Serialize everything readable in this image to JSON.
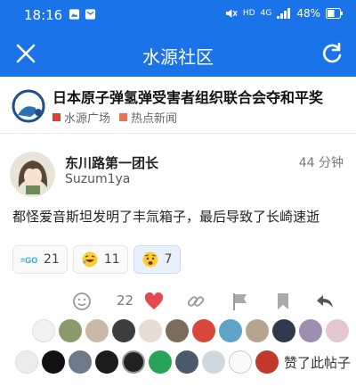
{
  "status": {
    "time": "18:16",
    "net_hd": "HD",
    "net_4g": "4G",
    "battery": "48%"
  },
  "appbar": {
    "title": "水源社区"
  },
  "topic": {
    "title": "日本原子弹氢弹受害者组织联合会夺和平奖",
    "categories": [
      {
        "label": "水源广场",
        "color": "#d94130"
      },
      {
        "label": "热点新闻",
        "color": "#e8744f"
      }
    ]
  },
  "post": {
    "author": "东川路第一团长",
    "handle": "Suzum1ya",
    "time": "44 分钟",
    "content": "都怪爱音斯坦发明了丰氚箱子，最后导致了长崎速逝"
  },
  "reactions": [
    {
      "icon": "go-icon",
      "count": "21"
    },
    {
      "icon": "rofl-emoji-icon",
      "count": "11"
    },
    {
      "icon": "worried-emoji-icon",
      "count": "7"
    }
  ],
  "actions": {
    "like_count": "22"
  },
  "likers": {
    "label": "赞了此帖子"
  },
  "colors": {
    "primary": "#1a73e8",
    "heart": "#e5484d"
  }
}
